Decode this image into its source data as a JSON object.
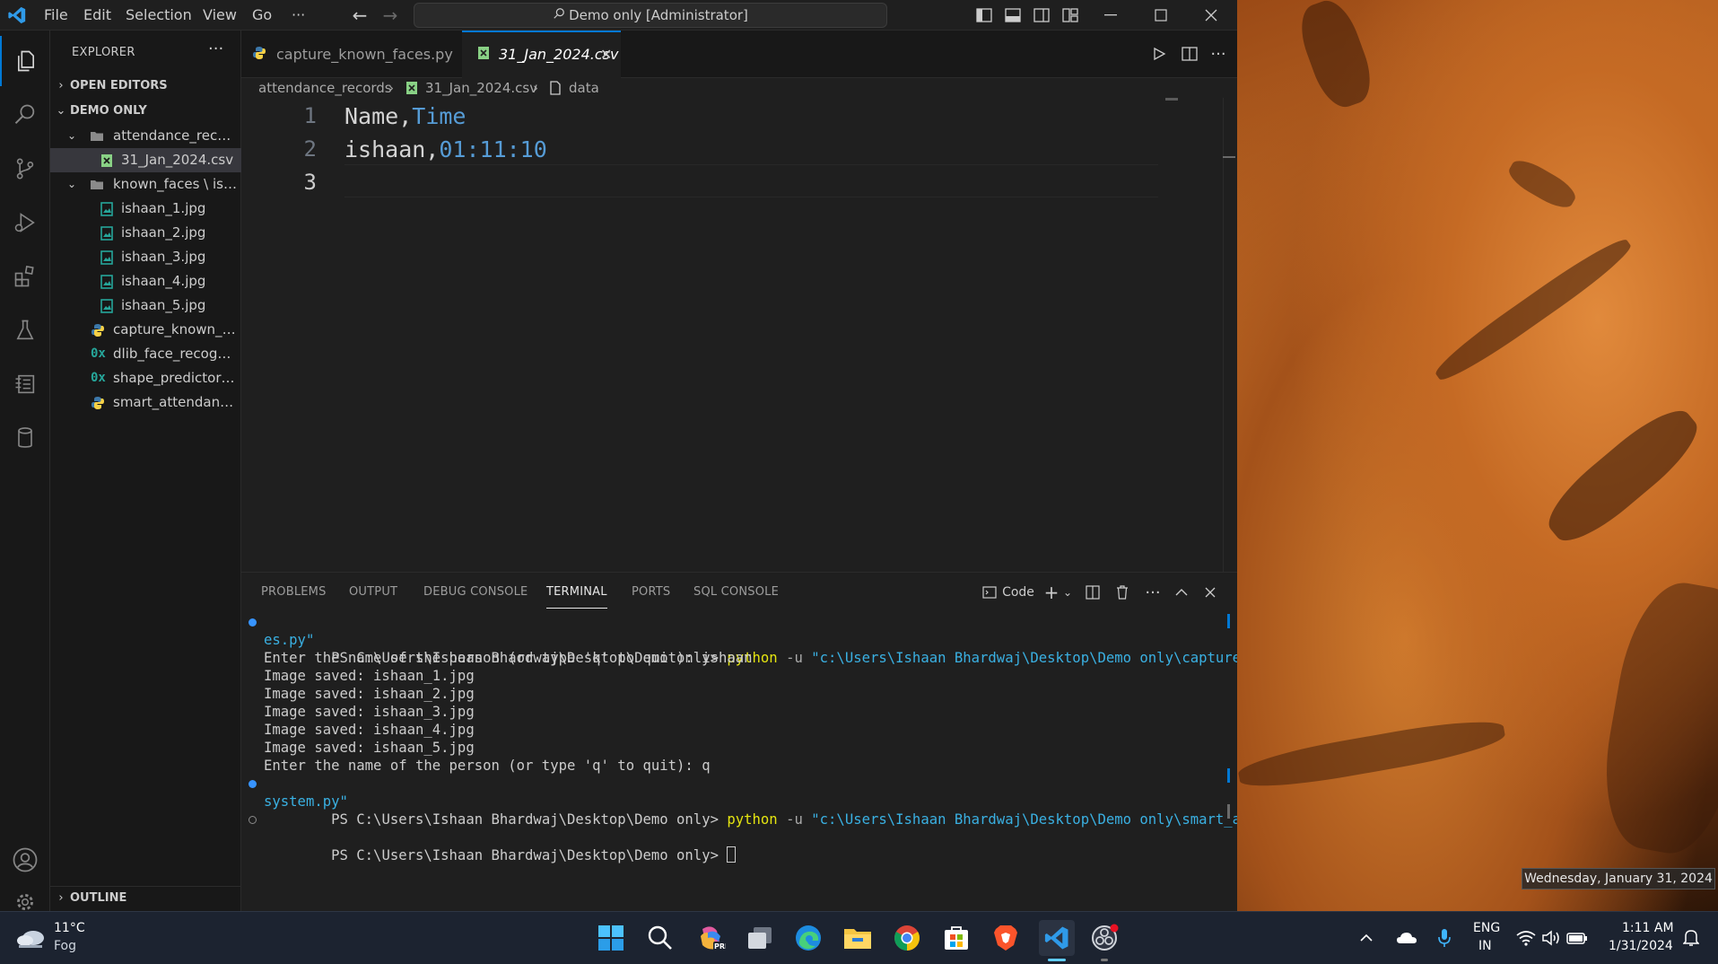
{
  "titlebar": {
    "menu": [
      "File",
      "Edit",
      "Selection",
      "View",
      "Go"
    ],
    "more": "···",
    "search": "Demo only [Administrator]",
    "back": "←",
    "forward": "→"
  },
  "sidebar": {
    "header": "EXPLORER",
    "more": "···",
    "open_editors": "OPEN EDITORS",
    "root": "DEMO ONLY",
    "outline": "OUTLINE",
    "tree": [
      {
        "label": "attendance_records",
        "type": "folder",
        "depth": 1
      },
      {
        "label": "31_Jan_2024.csv",
        "type": "csv",
        "depth": 2
      },
      {
        "label": "known_faces \\ isha...",
        "type": "folder",
        "depth": 1
      },
      {
        "label": "ishaan_1.jpg",
        "type": "image",
        "depth": 2
      },
      {
        "label": "ishaan_2.jpg",
        "type": "image",
        "depth": 2
      },
      {
        "label": "ishaan_3.jpg",
        "type": "image",
        "depth": 2
      },
      {
        "label": "ishaan_4.jpg",
        "type": "image",
        "depth": 2
      },
      {
        "label": "ishaan_5.jpg",
        "type": "image",
        "depth": 2
      },
      {
        "label": "capture_known_fa...",
        "type": "python",
        "depth": 1
      },
      {
        "label": "dlib_face_recognit...",
        "type": "binary",
        "depth": 1
      },
      {
        "label": "shape_predictor_6...",
        "type": "binary",
        "depth": 1
      },
      {
        "label": "smart_attendance...",
        "type": "python",
        "depth": 1
      }
    ]
  },
  "tabs": [
    {
      "label": "capture_known_faces.py",
      "active": false
    },
    {
      "label": "31_Jan_2024.csv",
      "active": true
    }
  ],
  "breadcrumb": [
    "attendance_records",
    "31_Jan_2024.csv",
    "data"
  ],
  "editor": {
    "lines": [
      {
        "num": "1",
        "a": "Name,",
        "b": "Time"
      },
      {
        "num": "2",
        "a": "ishaan,",
        "b": "01:11:10"
      },
      {
        "num": "3",
        "a": "",
        "b": ""
      }
    ]
  },
  "panel": {
    "tabs": [
      "PROBLEMS",
      "OUTPUT",
      "DEBUG CONSOLE",
      "TERMINAL",
      "PORTS",
      "SQL CONSOLE"
    ],
    "active_tab": "TERMINAL",
    "terminal_name": "Code",
    "terminal": {
      "prompt": "PS C:\\Users\\Ishaan Bhardwaj\\Desktop\\Demo only>",
      "cmd1_py": "python",
      "cmd1_flag": "-u",
      "cmd1_str_a": "\"c:\\Users\\Ishaan Bhardwaj\\Desktop\\Demo only\\capture_known_fac",
      "cmd1_str_b": "es.py\"",
      "out1": "Enter the name of the person (or type 'q' to quit): ishaan",
      "out2": "Image saved: ishaan_1.jpg",
      "out3": "Image saved: ishaan_2.jpg",
      "out4": "Image saved: ishaan_3.jpg",
      "out5": "Image saved: ishaan_4.jpg",
      "out6": "Image saved: ishaan_5.jpg",
      "out7": "Enter the name of the person (or type 'q' to quit): q",
      "cmd2_py": "python",
      "cmd2_flag": "-u",
      "cmd2_str_a": "\"c:\\Users\\Ishaan Bhardwaj\\Desktop\\Demo only\\smart_attendance_",
      "cmd2_str_b": "system.py\""
    }
  },
  "desktop": {
    "tooltip": "Wednesday, January 31, 2024"
  },
  "taskbar": {
    "weather_temp": "11°C",
    "weather_desc": "Fog",
    "lang": "ENG",
    "region": "IN",
    "time": "1:11 AM",
    "date": "1/31/2024"
  },
  "colors": {
    "accent": "#0078d4",
    "keyword_blue": "#569cd6",
    "terminal_yellow": "#e5e510",
    "terminal_string": "#3ab0e2",
    "csv_green": "#89d185"
  }
}
